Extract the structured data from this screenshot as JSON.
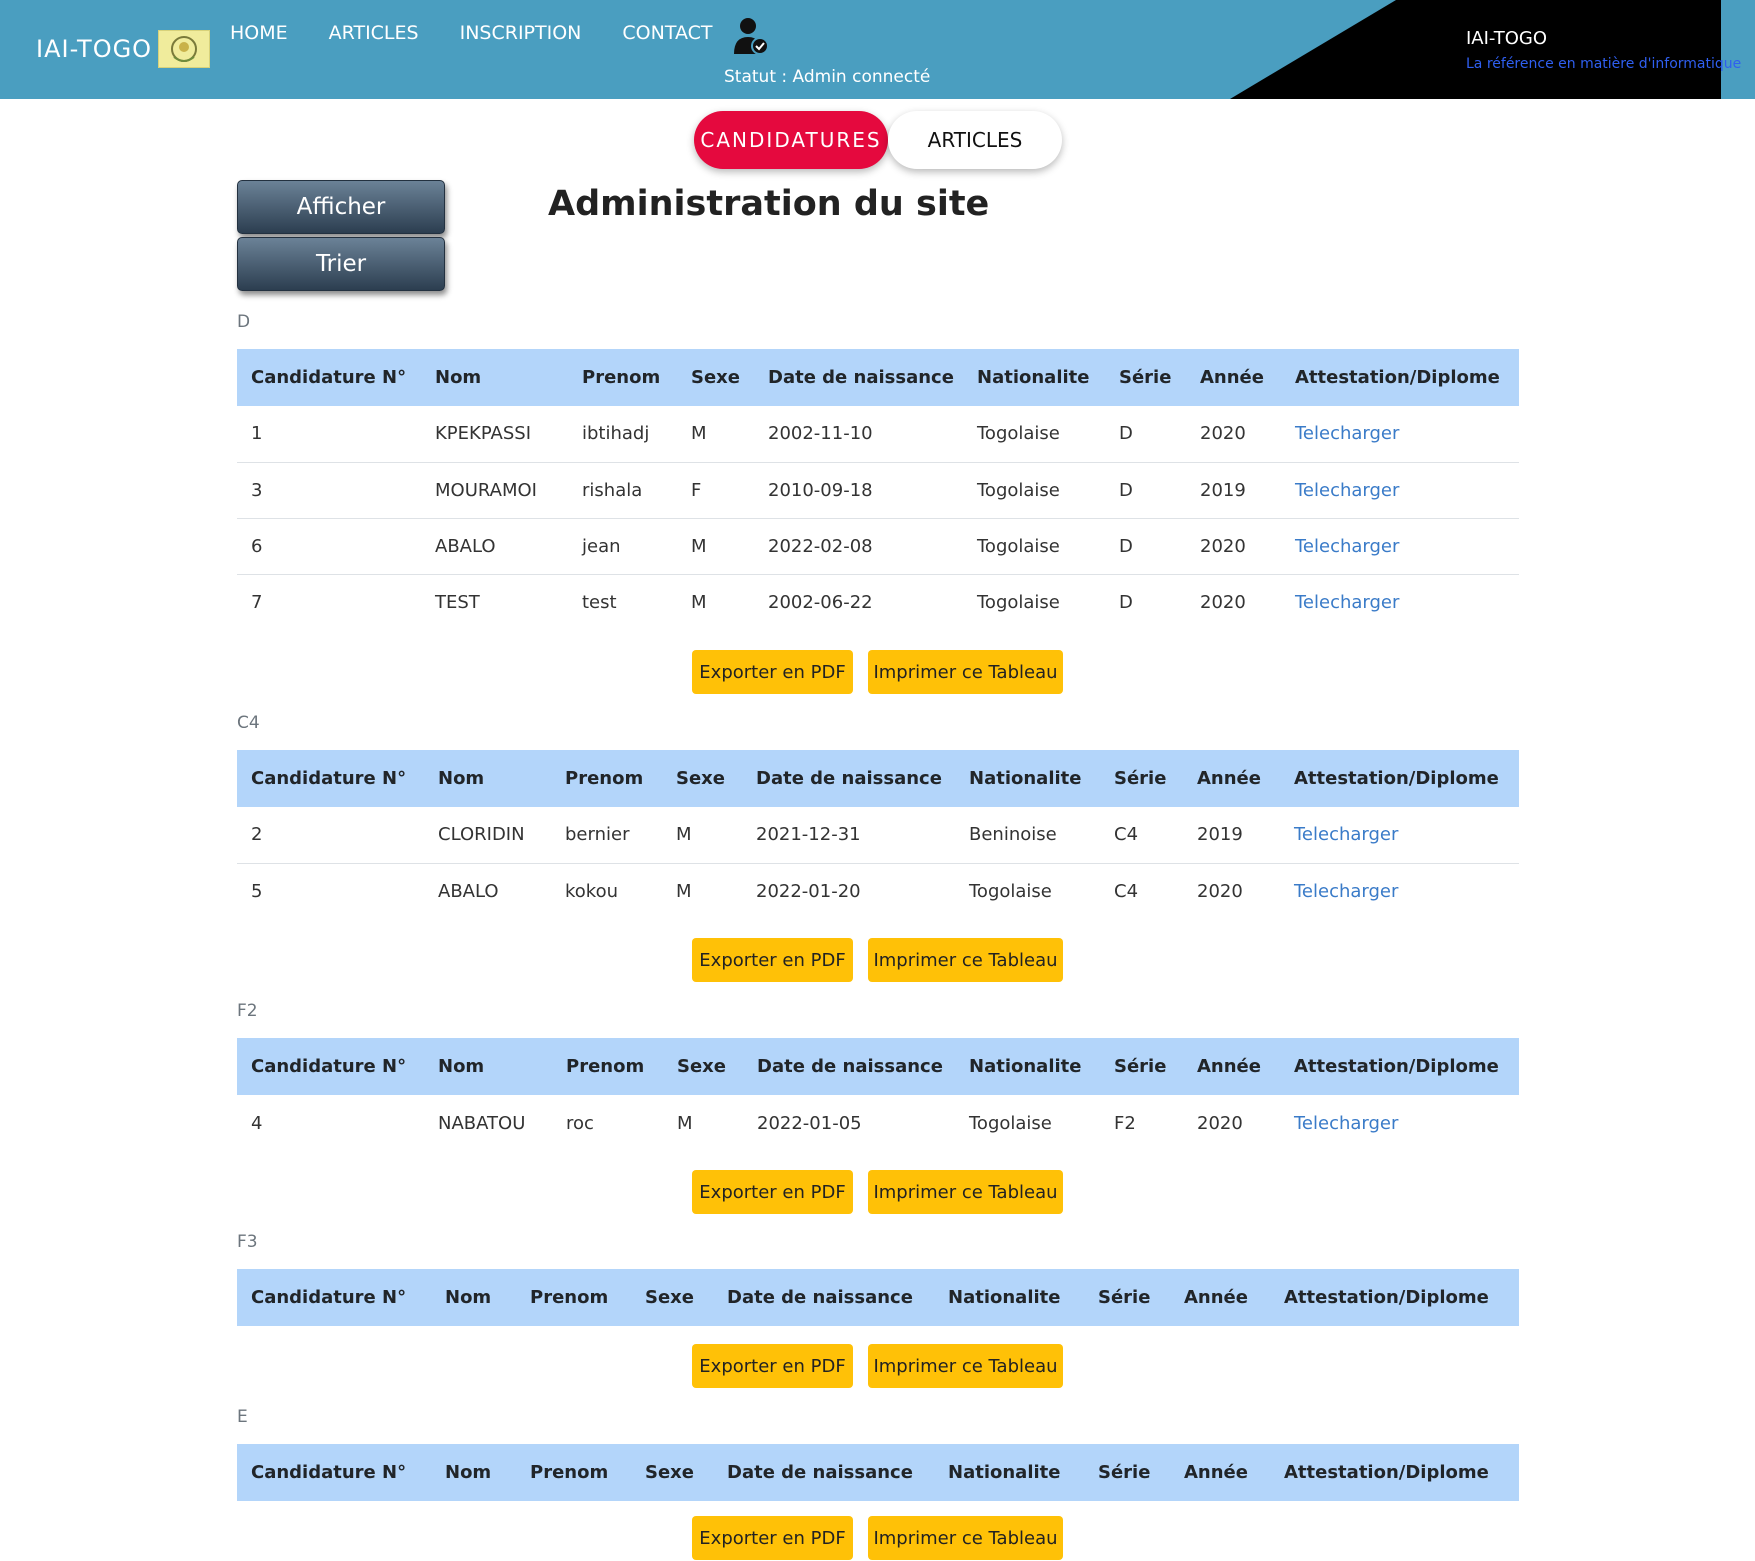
{
  "header": {
    "brand": "IAI-TOGO",
    "nav": [
      "HOME",
      "ARTICLES",
      "INSCRIPTION",
      "CONTACT"
    ],
    "status": "Statut : Admin connecté",
    "site_name": "IAI-TOGO",
    "tagline": "La référence en matière d'informatique"
  },
  "tabs": {
    "candidatures": "CANDIDATURES",
    "articles": "ARTICLES"
  },
  "side_buttons": {
    "afficher": "Afficher",
    "trier": "Trier"
  },
  "page_title": "Administration du site",
  "columns": [
    "Candidature N°",
    "Nom",
    "Prenom",
    "Sexe",
    "Date de naissance",
    "Nationalite",
    "Série",
    "Année",
    "Attestation/Diplome"
  ],
  "download_label": "Telecharger",
  "export_label": "Exporter en PDF",
  "print_label": "Imprimer ce Tableau",
  "sections": [
    {
      "name": "D",
      "rows": [
        [
          "1",
          "KPEKPASSI",
          "ibtihadj",
          "M",
          "2002-11-10",
          "Togolaise",
          "D",
          "2020"
        ],
        [
          "3",
          "MOURAMOI",
          "rishala",
          "F",
          "2010-09-18",
          "Togolaise",
          "D",
          "2019"
        ],
        [
          "6",
          "ABALO",
          "jean",
          "M",
          "2022-02-08",
          "Togolaise",
          "D",
          "2020"
        ],
        [
          "7",
          "TEST",
          "test",
          "M",
          "2002-06-22",
          "Togolaise",
          "D",
          "2020"
        ]
      ]
    },
    {
      "name": "C4",
      "rows": [
        [
          "2",
          "CLORIDIN",
          "bernier",
          "M",
          "2021-12-31",
          "Beninoise",
          "C4",
          "2019"
        ],
        [
          "5",
          "ABALO",
          "kokou",
          "M",
          "2022-01-20",
          "Togolaise",
          "C4",
          "2020"
        ]
      ]
    },
    {
      "name": "F2",
      "rows": [
        [
          "4",
          "NABATOU",
          "roc",
          "M",
          "2022-01-05",
          "Togolaise",
          "F2",
          "2020"
        ]
      ]
    },
    {
      "name": "F3",
      "rows": []
    },
    {
      "name": "E",
      "rows": []
    }
  ]
}
